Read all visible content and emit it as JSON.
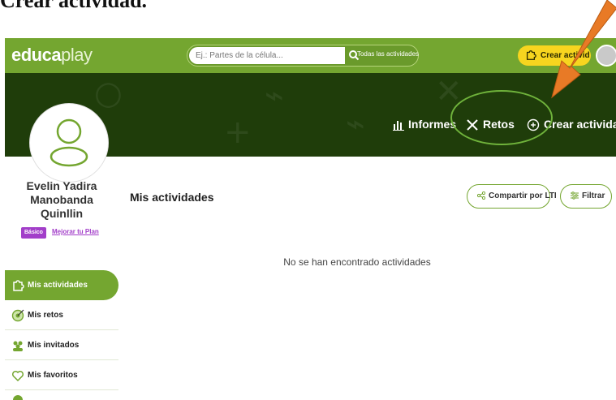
{
  "caption": "Crear actividad.",
  "app": {
    "logo_left": "educa",
    "logo_right": "play"
  },
  "search": {
    "placeholder": "Ej.: Partes de la célula...",
    "scope_label": "Todas las actividades"
  },
  "header": {
    "create_button": "Crear activid"
  },
  "banner": {
    "reports": "Informes",
    "challenges": "Retos",
    "create_activity": "Crear actividad"
  },
  "profile": {
    "name_line1": "Evelin Yadira",
    "name_line2": "Manobanda",
    "name_line3": "Quinllin",
    "plan_badge": "Básico",
    "upgrade_link": "Mejorar tu Plan"
  },
  "sidebar": {
    "items": [
      {
        "label": "Mis actividades",
        "icon": "puzzle-icon",
        "active": true
      },
      {
        "label": "Mis retos",
        "icon": "target-icon",
        "active": false
      },
      {
        "label": "Mis invitados",
        "icon": "users-icon",
        "active": false
      },
      {
        "label": "Mis favoritos",
        "icon": "heart-icon",
        "active": false
      }
    ]
  },
  "main": {
    "title": "Mis actividades",
    "share_lti": "Compartir por LTI",
    "filter": "Filtrar",
    "empty_message": "No se han encontrado actividades"
  },
  "colors": {
    "brand_green": "#74a630",
    "banner_dark": "#1f3d0a",
    "create_yellow": "#f7d51f",
    "badge_purple": "#a23ec9",
    "arrow_orange": "#e87a26",
    "callout_green": "#6fb23b"
  }
}
